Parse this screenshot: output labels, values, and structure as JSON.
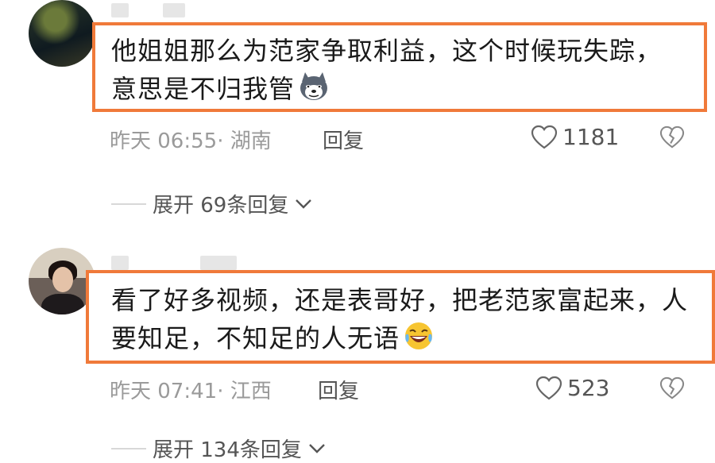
{
  "comments": [
    {
      "text": "他姐姐那么为范家争取利益，这个时候玩失踪，意思是不归我管",
      "emoji": "husky-dog-emoji",
      "time": "昨天 06:55",
      "location": "· 湖南",
      "reply_label": "回复",
      "likes": "1181",
      "expand_label": "展开 69条回复"
    },
    {
      "text": "看了好多视频，还是表哥好，把老范家富起来，人要知足，不知足的人无语",
      "emoji": "laughing-crying-emoji",
      "time": "昨天 07:41",
      "location": "· 江西",
      "reply_label": "回复",
      "likes": "523",
      "expand_label": "展开 134条回复"
    }
  ],
  "colors": {
    "highlight_border": "#f07a3a",
    "meta_text": "#9a9a9a"
  }
}
